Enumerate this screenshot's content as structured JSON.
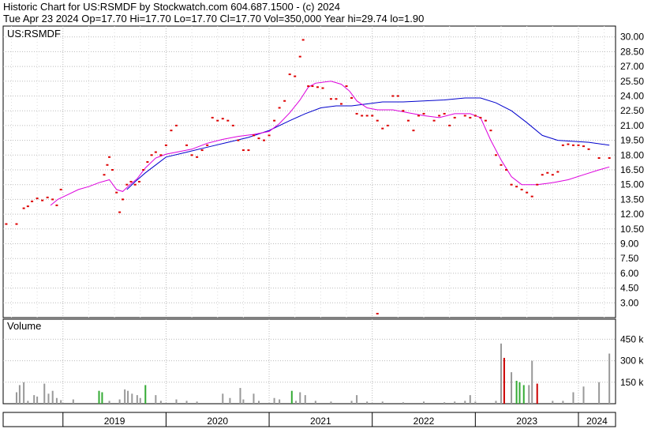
{
  "header": {
    "line1": "Historic Chart for US:RSMDF by Stockwatch.com 604.687.1500 - (c) 2024",
    "line2": "Tue Apr 23 2024   Op=17.70   Hi=17.70   Lo=17.70   Cl=17.70   Vol=350,000   Year hi=29.74   lo=1.90"
  },
  "colors": {
    "price": "#dd0000",
    "ma_long": "#0000cc",
    "ma_short": "#dd00dd",
    "vol_up": "#33aa33",
    "vol_down": "#cc0000",
    "vol_neutral": "#999999",
    "grid": "#bbbbbb"
  },
  "chart_data": [
    {
      "type": "line",
      "panel_label": "US:RSMDF",
      "y_ticks": [
        "30.00",
        "28.50",
        "27.00",
        "25.50",
        "24.00",
        "22.50",
        "21.00",
        "19.50",
        "18.00",
        "16.50",
        "15.00",
        "13.50",
        "12.00",
        "10.50",
        "9.00",
        "7.50",
        "6.00",
        "4.50",
        "3.00"
      ],
      "ylim": [
        1.5,
        31.1
      ],
      "xlim": [
        2018.42,
        2024.36
      ],
      "x_year_labels": [
        {
          "label": "2019",
          "pos": 2019.0
        },
        {
          "label": "2020",
          "pos": 2020.0
        },
        {
          "label": "2021",
          "pos": 2021.0
        },
        {
          "label": "2022",
          "pos": 2022.0
        },
        {
          "label": "2023",
          "pos": 2023.0
        },
        {
          "label": "2024",
          "pos": 2024.0
        }
      ],
      "price_points": [
        [
          2018.45,
          11.0
        ],
        [
          2018.55,
          11.0
        ],
        [
          2018.62,
          12.6
        ],
        [
          2018.66,
          12.8
        ],
        [
          2018.7,
          13.3
        ],
        [
          2018.75,
          13.6
        ],
        [
          2018.8,
          13.4
        ],
        [
          2018.85,
          13.7
        ],
        [
          2018.9,
          13.5
        ],
        [
          2018.94,
          12.9
        ],
        [
          2018.98,
          14.5
        ],
        [
          2019.4,
          16.0
        ],
        [
          2019.43,
          17.0
        ],
        [
          2019.45,
          17.8
        ],
        [
          2019.48,
          16.5
        ],
        [
          2019.52,
          14.2
        ],
        [
          2019.55,
          12.2
        ],
        [
          2019.58,
          13.5
        ],
        [
          2019.62,
          15.0
        ],
        [
          2019.66,
          15.3
        ],
        [
          2019.7,
          15.0
        ],
        [
          2019.74,
          15.3
        ],
        [
          2019.78,
          16.5
        ],
        [
          2019.82,
          17.3
        ],
        [
          2019.86,
          18.0
        ],
        [
          2019.9,
          18.3
        ],
        [
          2019.95,
          18.0
        ],
        [
          2020.0,
          19.0
        ],
        [
          2020.05,
          20.5
        ],
        [
          2020.1,
          21.0
        ],
        [
          2020.2,
          19.0
        ],
        [
          2020.25,
          18.0
        ],
        [
          2020.3,
          17.8
        ],
        [
          2020.35,
          18.5
        ],
        [
          2020.4,
          19.0
        ],
        [
          2020.45,
          21.8
        ],
        [
          2020.5,
          21.5
        ],
        [
          2020.55,
          21.7
        ],
        [
          2020.6,
          21.5
        ],
        [
          2020.65,
          21.0
        ],
        [
          2020.7,
          19.5
        ],
        [
          2020.75,
          18.5
        ],
        [
          2020.8,
          18.5
        ],
        [
          2020.85,
          20.0
        ],
        [
          2020.9,
          19.7
        ],
        [
          2020.95,
          19.5
        ],
        [
          2021.0,
          20.0
        ],
        [
          2021.05,
          21.5
        ],
        [
          2021.1,
          22.8
        ],
        [
          2021.15,
          23.5
        ],
        [
          2021.2,
          26.2
        ],
        [
          2021.25,
          26.0
        ],
        [
          2021.3,
          28.0
        ],
        [
          2021.33,
          29.7
        ],
        [
          2021.38,
          25.0
        ],
        [
          2021.42,
          25.0
        ],
        [
          2021.47,
          24.9
        ],
        [
          2021.52,
          24.8
        ],
        [
          2021.6,
          23.7
        ],
        [
          2021.65,
          23.7
        ],
        [
          2021.7,
          23.2
        ],
        [
          2021.75,
          25.0
        ],
        [
          2021.8,
          23.8
        ],
        [
          2021.85,
          22.2
        ],
        [
          2021.9,
          22.0
        ],
        [
          2021.95,
          22.0
        ],
        [
          2022.0,
          22.0
        ],
        [
          2022.05,
          21.5
        ],
        [
          2022.1,
          20.7
        ],
        [
          2022.15,
          21.0
        ],
        [
          2022.2,
          24.0
        ],
        [
          2022.25,
          24.0
        ],
        [
          2022.3,
          22.5
        ],
        [
          2022.35,
          21.5
        ],
        [
          2022.4,
          20.5
        ],
        [
          2022.45,
          22.0
        ],
        [
          2022.5,
          22.2
        ],
        [
          2022.6,
          21.5
        ],
        [
          2022.65,
          22.0
        ],
        [
          2022.7,
          22.2
        ],
        [
          2022.75,
          21.0
        ],
        [
          2022.8,
          21.8
        ],
        [
          2022.9,
          22.0
        ],
        [
          2022.95,
          21.8
        ],
        [
          2023.0,
          22.0
        ],
        [
          2023.05,
          21.8
        ],
        [
          2023.1,
          21.5
        ],
        [
          2023.15,
          20.5
        ],
        [
          2023.2,
          18.0
        ],
        [
          2023.25,
          17.0
        ],
        [
          2023.3,
          16.5
        ],
        [
          2023.35,
          15.0
        ],
        [
          2023.4,
          14.8
        ],
        [
          2023.45,
          14.5
        ],
        [
          2023.5,
          14.2
        ],
        [
          2023.55,
          13.8
        ],
        [
          2023.6,
          15.0
        ],
        [
          2023.65,
          16.0
        ],
        [
          2023.7,
          16.2
        ],
        [
          2023.75,
          16.0
        ],
        [
          2023.8,
          16.3
        ],
        [
          2023.85,
          19.0
        ],
        [
          2023.9,
          19.1
        ],
        [
          2023.95,
          19.0
        ],
        [
          2024.0,
          19.0
        ],
        [
          2024.05,
          18.9
        ],
        [
          2024.1,
          18.6
        ],
        [
          2024.2,
          17.7
        ],
        [
          2024.3,
          17.7
        ]
      ],
      "outlier_point": [
        2022.05,
        1.9
      ],
      "ma_long_points": [
        [
          2019.62,
          14.5
        ],
        [
          2019.7,
          15.3
        ],
        [
          2019.8,
          16.2
        ],
        [
          2019.9,
          17.0
        ],
        [
          2020.0,
          17.8
        ],
        [
          2020.2,
          18.3
        ],
        [
          2020.4,
          18.8
        ],
        [
          2020.6,
          19.3
        ],
        [
          2020.8,
          19.8
        ],
        [
          2021.0,
          20.5
        ],
        [
          2021.2,
          21.5
        ],
        [
          2021.35,
          22.2
        ],
        [
          2021.5,
          22.8
        ],
        [
          2021.65,
          23.0
        ],
        [
          2021.8,
          23.0
        ],
        [
          2021.95,
          23.2
        ],
        [
          2022.1,
          23.4
        ],
        [
          2022.3,
          23.4
        ],
        [
          2022.5,
          23.5
        ],
        [
          2022.7,
          23.6
        ],
        [
          2022.9,
          23.8
        ],
        [
          2023.05,
          23.8
        ],
        [
          2023.2,
          23.3
        ],
        [
          2023.35,
          22.5
        ],
        [
          2023.5,
          21.3
        ],
        [
          2023.65,
          20.0
        ],
        [
          2023.8,
          19.5
        ],
        [
          2023.95,
          19.4
        ],
        [
          2024.1,
          19.3
        ],
        [
          2024.3,
          19.0
        ]
      ],
      "ma_short_points": [
        [
          2018.88,
          12.9
        ],
        [
          2018.95,
          13.5
        ],
        [
          2019.05,
          14.0
        ],
        [
          2019.15,
          14.5
        ],
        [
          2019.25,
          14.8
        ],
        [
          2019.35,
          15.2
        ],
        [
          2019.45,
          15.5
        ],
        [
          2019.52,
          14.5
        ],
        [
          2019.58,
          14.3
        ],
        [
          2019.65,
          15.0
        ],
        [
          2019.72,
          15.6
        ],
        [
          2019.8,
          16.7
        ],
        [
          2019.9,
          17.7
        ],
        [
          2020.0,
          18.1
        ],
        [
          2020.1,
          18.3
        ],
        [
          2020.25,
          18.6
        ],
        [
          2020.4,
          19.2
        ],
        [
          2020.55,
          19.6
        ],
        [
          2020.7,
          19.9
        ],
        [
          2020.85,
          20.1
        ],
        [
          2021.0,
          20.4
        ],
        [
          2021.1,
          21.2
        ],
        [
          2021.2,
          22.3
        ],
        [
          2021.3,
          23.6
        ],
        [
          2021.38,
          24.9
        ],
        [
          2021.45,
          25.3
        ],
        [
          2021.6,
          25.5
        ],
        [
          2021.7,
          25.2
        ],
        [
          2021.78,
          24.5
        ],
        [
          2021.85,
          23.5
        ],
        [
          2021.95,
          22.8
        ],
        [
          2022.05,
          22.6
        ],
        [
          2022.2,
          22.6
        ],
        [
          2022.35,
          22.3
        ],
        [
          2022.5,
          22.0
        ],
        [
          2022.65,
          21.8
        ],
        [
          2022.8,
          22.2
        ],
        [
          2022.95,
          22.2
        ],
        [
          2023.05,
          21.8
        ],
        [
          2023.15,
          19.5
        ],
        [
          2023.25,
          17.5
        ],
        [
          2023.35,
          15.8
        ],
        [
          2023.45,
          15.0
        ],
        [
          2023.6,
          15.0
        ],
        [
          2023.75,
          15.2
        ],
        [
          2023.9,
          15.5
        ],
        [
          2024.05,
          16.0
        ],
        [
          2024.2,
          16.5
        ],
        [
          2024.3,
          16.8
        ]
      ]
    },
    {
      "type": "bar",
      "panel_label": "Volume",
      "y_ticks": [
        "450 k",
        "300 k",
        "150 k"
      ],
      "y_tick_values": [
        450000,
        300000,
        150000
      ],
      "ylim": [
        0,
        590000
      ],
      "volume_bars": [
        [
          2018.55,
          80000,
          "n"
        ],
        [
          2018.58,
          130000,
          "n"
        ],
        [
          2018.62,
          150000,
          "n"
        ],
        [
          2018.66,
          20000,
          "n"
        ],
        [
          2018.72,
          60000,
          "n"
        ],
        [
          2018.75,
          50000,
          "n"
        ],
        [
          2018.82,
          140000,
          "n"
        ],
        [
          2018.86,
          70000,
          "n"
        ],
        [
          2018.9,
          90000,
          "n"
        ],
        [
          2018.94,
          40000,
          "n"
        ],
        [
          2018.98,
          25000,
          "n"
        ],
        [
          2019.1,
          30000,
          "n"
        ],
        [
          2019.35,
          90000,
          "u"
        ],
        [
          2019.38,
          80000,
          "u"
        ],
        [
          2019.45,
          20000,
          "n"
        ],
        [
          2019.55,
          30000,
          "n"
        ],
        [
          2019.6,
          100000,
          "n"
        ],
        [
          2019.63,
          90000,
          "n"
        ],
        [
          2019.67,
          70000,
          "n"
        ],
        [
          2019.72,
          60000,
          "n"
        ],
        [
          2019.75,
          40000,
          "n"
        ],
        [
          2019.8,
          130000,
          "u"
        ],
        [
          2019.9,
          60000,
          "n"
        ],
        [
          2019.95,
          20000,
          "n"
        ],
        [
          2020.1,
          30000,
          "n"
        ],
        [
          2020.2,
          20000,
          "n"
        ],
        [
          2020.3,
          15000,
          "n"
        ],
        [
          2020.55,
          70000,
          "n"
        ],
        [
          2020.62,
          40000,
          "n"
        ],
        [
          2020.72,
          110000,
          "n"
        ],
        [
          2020.75,
          30000,
          "n"
        ],
        [
          2020.85,
          70000,
          "n"
        ],
        [
          2020.9,
          20000,
          "n"
        ],
        [
          2021.05,
          40000,
          "n"
        ],
        [
          2021.1,
          30000,
          "n"
        ],
        [
          2021.22,
          90000,
          "u"
        ],
        [
          2021.26,
          20000,
          "n"
        ],
        [
          2021.3,
          80000,
          "n"
        ],
        [
          2021.35,
          60000,
          "n"
        ],
        [
          2021.45,
          20000,
          "n"
        ],
        [
          2021.6,
          15000,
          "n"
        ],
        [
          2021.8,
          20000,
          "n"
        ],
        [
          2021.85,
          60000,
          "n"
        ],
        [
          2021.95,
          15000,
          "n"
        ],
        [
          2022.1,
          15000,
          "n"
        ],
        [
          2022.3,
          10000,
          "n"
        ],
        [
          2022.5,
          15000,
          "n"
        ],
        [
          2022.7,
          10000,
          "n"
        ],
        [
          2022.8,
          15000,
          "n"
        ],
        [
          2022.9,
          20000,
          "n"
        ],
        [
          2022.95,
          60000,
          "n"
        ],
        [
          2023.0,
          15000,
          "n"
        ],
        [
          2023.2,
          20000,
          "n"
        ],
        [
          2023.25,
          420000,
          "n"
        ],
        [
          2023.28,
          320000,
          "d"
        ],
        [
          2023.35,
          220000,
          "n"
        ],
        [
          2023.4,
          160000,
          "u"
        ],
        [
          2023.43,
          150000,
          "u"
        ],
        [
          2023.47,
          130000,
          "u"
        ],
        [
          2023.52,
          130000,
          "n"
        ],
        [
          2023.55,
          300000,
          "n"
        ],
        [
          2023.6,
          140000,
          "d"
        ],
        [
          2023.75,
          20000,
          "n"
        ],
        [
          2023.85,
          20000,
          "n"
        ],
        [
          2023.95,
          80000,
          "n"
        ],
        [
          2024.05,
          120000,
          "n"
        ],
        [
          2024.2,
          150000,
          "n"
        ],
        [
          2024.3,
          350000,
          "n"
        ]
      ]
    }
  ]
}
